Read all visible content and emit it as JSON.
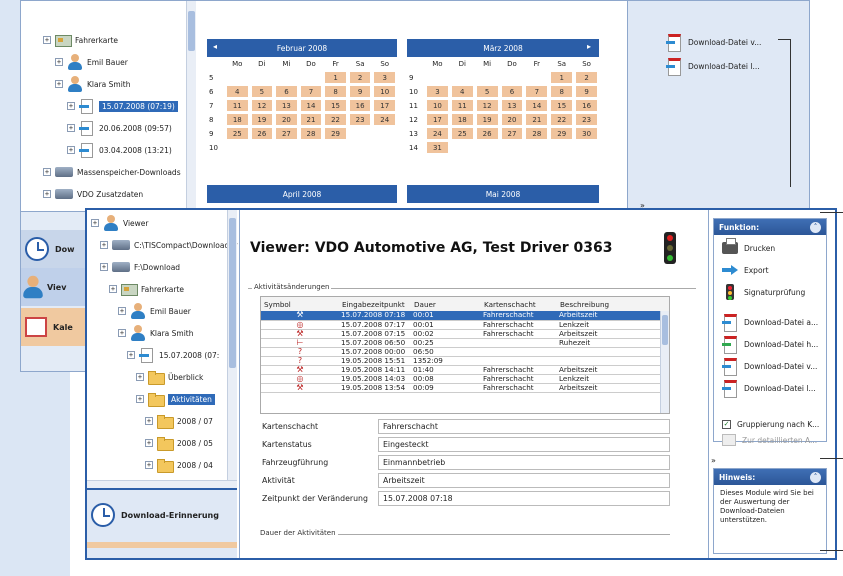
{
  "back_window": {
    "tree": [
      {
        "label": "Fahrerkarte",
        "level": 1,
        "icon": "card-icon"
      },
      {
        "label": "Emil Bauer",
        "level": 2,
        "icon": "person-icon"
      },
      {
        "label": "Klara Smith",
        "level": 2,
        "icon": "person-icon"
      },
      {
        "label": "15.07.2008 (07:19)",
        "level": 3,
        "icon": "download-icon",
        "selected": true
      },
      {
        "label": "20.06.2008 (09:57)",
        "level": 3,
        "icon": "download-icon"
      },
      {
        "label": "03.04.2008 (13:21)",
        "level": 3,
        "icon": "download-icon"
      },
      {
        "label": "Massenspeicher-Downloads",
        "level": 1,
        "icon": "drive-icon"
      },
      {
        "label": "VDO Zusatzdaten",
        "level": 1,
        "icon": "drive-icon"
      }
    ],
    "calendar_feb": {
      "title": "Februar 2008",
      "weekdays": [
        "Mo",
        "Di",
        "Mi",
        "Do",
        "Fr",
        "Sa",
        "So"
      ],
      "weeks": [
        {
          "wk": "5",
          "days": [
            "",
            "",
            "",
            "",
            "1",
            "2",
            "3"
          ]
        },
        {
          "wk": "6",
          "days": [
            "4",
            "5",
            "6",
            "7",
            "8",
            "9",
            "10"
          ]
        },
        {
          "wk": "7",
          "days": [
            "11",
            "12",
            "13",
            "14",
            "15",
            "16",
            "17"
          ]
        },
        {
          "wk": "8",
          "days": [
            "18",
            "19",
            "20",
            "21",
            "22",
            "23",
            "24"
          ]
        },
        {
          "wk": "9",
          "days": [
            "25",
            "26",
            "27",
            "28",
            "29",
            "",
            ""
          ]
        },
        {
          "wk": "10",
          "days": [
            "",
            "",
            "",
            "",
            "",
            "",
            ""
          ]
        }
      ]
    },
    "calendar_mar": {
      "title": "März 2008",
      "weekdays": [
        "Mo",
        "Di",
        "Mi",
        "Do",
        "Fr",
        "Sa",
        "So"
      ],
      "weeks": [
        {
          "wk": "9",
          "days": [
            "",
            "",
            "",
            "",
            "",
            "1",
            "2"
          ]
        },
        {
          "wk": "10",
          "days": [
            "3",
            "4",
            "5",
            "6",
            "7",
            "8",
            "9"
          ]
        },
        {
          "wk": "11",
          "days": [
            "10",
            "11",
            "12",
            "13",
            "14",
            "15",
            "16"
          ]
        },
        {
          "wk": "12",
          "days": [
            "17",
            "18",
            "19",
            "20",
            "21",
            "22",
            "23"
          ]
        },
        {
          "wk": "13",
          "days": [
            "24",
            "25",
            "26",
            "27",
            "28",
            "29",
            "30"
          ]
        },
        {
          "wk": "14",
          "days": [
            "31",
            "",
            "",
            "",
            "",
            "",
            ""
          ]
        }
      ]
    },
    "calendar_apr_title": "April 2008",
    "calendar_may_title": "Mai 2008",
    "right_files": [
      "Download-Datei v...",
      "Download-Datei l..."
    ],
    "expand_glyph": "»",
    "nav": [
      {
        "label": "Dow"
      },
      {
        "label": "Viev"
      },
      {
        "label": "Kale"
      }
    ]
  },
  "front_window": {
    "tree": [
      {
        "label": "Viewer",
        "level": 0,
        "icon": "person-icon"
      },
      {
        "label": "C:\\TISCompact\\DownloadAr",
        "level": 1,
        "icon": "drive-icon"
      },
      {
        "label": "F:\\Download",
        "level": 1,
        "icon": "drive-icon"
      },
      {
        "label": "Fahrerkarte",
        "level": 2,
        "icon": "card-icon"
      },
      {
        "label": "Emil Bauer",
        "level": 3,
        "icon": "person-icon"
      },
      {
        "label": "Klara Smith",
        "level": 3,
        "icon": "person-icon"
      },
      {
        "label": "15.07.2008 (07:",
        "level": 4,
        "icon": "download-icon"
      },
      {
        "label": "Überblick",
        "level": 5,
        "icon": "folder-icon"
      },
      {
        "label": "Aktivitäten",
        "level": 5,
        "icon": "folder-icon",
        "selected": true
      },
      {
        "label": "2008 / 07",
        "level": 6,
        "icon": "folder-icon"
      },
      {
        "label": "2008 / 05",
        "level": 6,
        "icon": "folder-icon"
      },
      {
        "label": "2008 / 04",
        "level": 6,
        "icon": "folder-icon"
      }
    ],
    "nav_download_reminder": "Download-Erinnerung",
    "viewer_title": "Viewer: VDO Automotive AG, Test Driver 0363",
    "group_activity_changes": "Aktivitätsänderungen",
    "table": {
      "headers": [
        "Symbol",
        "Eingabezeitpunkt",
        "Dauer",
        "Kartenschacht",
        "Beschreibung"
      ],
      "rows": [
        {
          "sym": "⚒",
          "time": "15.07.2008 07:18",
          "dur": "00:01",
          "slot": "Fahrerschacht",
          "desc": "Arbeitszeit",
          "selected": true
        },
        {
          "sym": "◎",
          "time": "15.07.2008 07:17",
          "dur": "00:01",
          "slot": "Fahrerschacht",
          "desc": "Lenkzeit"
        },
        {
          "sym": "⚒",
          "time": "15.07.2008 07:15",
          "dur": "00:02",
          "slot": "Fahrerschacht",
          "desc": "Arbeitszeit"
        },
        {
          "sym": "⊢",
          "time": "15.07.2008 06:50",
          "dur": "00:25",
          "slot": "",
          "desc": "Ruhezeit"
        },
        {
          "sym": "?",
          "time": "15.07.2008 00:00",
          "dur": "06:50",
          "slot": "",
          "desc": ""
        },
        {
          "sym": "?",
          "time": "19.05.2008 15:51",
          "dur": "1352:09",
          "slot": "",
          "desc": ""
        },
        {
          "sym": "⚒",
          "time": "19.05.2008 14:11",
          "dur": "01:40",
          "slot": "Fahrerschacht",
          "desc": "Arbeitszeit"
        },
        {
          "sym": "◎",
          "time": "19.05.2008 14:03",
          "dur": "00:08",
          "slot": "Fahrerschacht",
          "desc": "Lenkzeit"
        },
        {
          "sym": "⚒",
          "time": "19.05.2008 13:54",
          "dur": "00:09",
          "slot": "Fahrerschacht",
          "desc": "Arbeitszeit"
        }
      ]
    },
    "details": [
      {
        "label": "Kartenschacht",
        "value": "Fahrerschacht"
      },
      {
        "label": "Kartenstatus",
        "value": "Eingesteckt"
      },
      {
        "label": "Fahrzeugführung",
        "value": "Einmannbetrieb"
      },
      {
        "label": "Aktivität",
        "value": "Arbeitszeit"
      },
      {
        "label": "Zeitpunkt der Veränderung",
        "value": "15.07.2008 07:18"
      }
    ],
    "group_activity_duration": "Dauer der Aktivitäten",
    "function_panel": {
      "title": "Funktion:",
      "items": [
        {
          "label": "Drucken",
          "icon": "printer-icon"
        },
        {
          "label": "Export",
          "icon": "export-icon"
        },
        {
          "label": "Signaturprüfung",
          "icon": "traffic-light-icon"
        },
        {
          "label": "Download-Datei a...",
          "icon": "file-icon"
        },
        {
          "label": "Download-Datei h...",
          "icon": "file-add-icon"
        },
        {
          "label": "Download-Datei v...",
          "icon": "file-icon"
        },
        {
          "label": "Download-Datei l...",
          "icon": "file-icon"
        }
      ],
      "grouping_label": "Gruppierung nach K...",
      "detail_label": "Zur detaillierten A..."
    },
    "hint_panel": {
      "title": "Hinweis:",
      "text": "Dieses Module wird Sie bei der Auswertung der Download-Dateien unterstützen."
    },
    "expand_glyph": "»",
    "collapse_glyph": "«"
  },
  "colors": {
    "accent_blue": "#2b5ea8",
    "selection_blue": "#2f6ab8",
    "calendar_day": "#f0c39c",
    "background_panel": "#dbe6f4"
  }
}
